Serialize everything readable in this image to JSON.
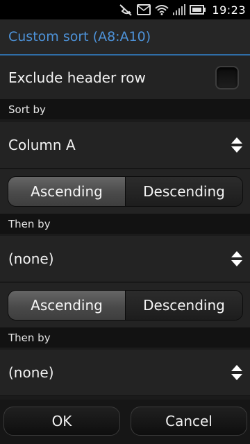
{
  "status_bar": {
    "time": "19:23",
    "icons": [
      "silent-icon",
      "message-icon",
      "wifi-icon",
      "signal-icon",
      "battery-icon"
    ]
  },
  "dialog": {
    "title": "Custom sort (A8:A10)",
    "exclude_header_label": "Exclude header row",
    "exclude_header_checked": false,
    "sort_by_label": "Sort by",
    "sort_by_value": "Column A",
    "sort_by_order": {
      "ascending": "Ascending",
      "descending": "Descending",
      "selected": "Ascending"
    },
    "then_by_1_label": "Then by",
    "then_by_1_value": "(none)",
    "then_by_1_order": {
      "ascending": "Ascending",
      "descending": "Descending",
      "selected": "Ascending"
    },
    "then_by_2_label": "Then by",
    "then_by_2_value": "(none)"
  },
  "buttons": {
    "ok": "OK",
    "cancel": "Cancel"
  },
  "colors": {
    "title": "#4d92d8",
    "accent_line": "#2f6da6",
    "background": "#1b1b1b"
  }
}
